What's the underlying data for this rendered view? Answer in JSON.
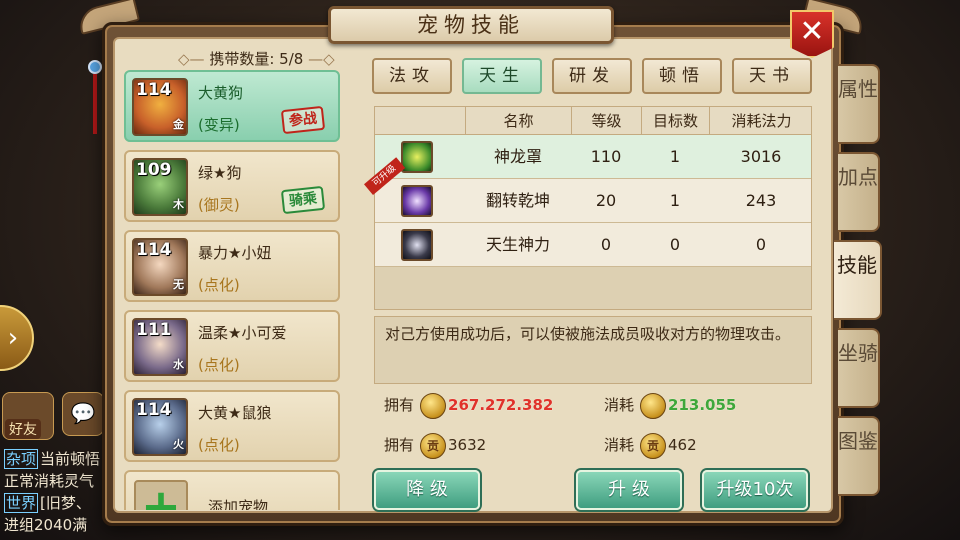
{
  "background": {
    "friend_label": "好友",
    "chat_lines": [
      {
        "tag": "杂项",
        "text": "当前顿悟"
      },
      {
        "tag": "",
        "text": "正常消耗灵气"
      },
      {
        "tag": "世界",
        "text": "[旧梦、"
      },
      {
        "tag": "",
        "text": "进组2040满"
      }
    ]
  },
  "title": "宠物技能",
  "close_label": "✕",
  "carry": {
    "label": "携带数量:",
    "value": "5/8"
  },
  "pets": [
    {
      "level": "114",
      "name": "大黄狗",
      "sub": "(变异)",
      "elem": "金",
      "stamp": "参战",
      "stamp_color": "#c0241a",
      "avatar_color": "#c8602a",
      "selected": true
    },
    {
      "level": "109",
      "name": "绿★狗",
      "sub": "(御灵)",
      "elem": "木",
      "stamp": "骑乘",
      "stamp_color": "#2a8a3a",
      "avatar_color": "#4a7a3a",
      "selected": false
    },
    {
      "level": "114",
      "name": "暴力★小妞",
      "sub": "(点化)",
      "elem": "无",
      "stamp": "",
      "avatar_color": "#a0785a",
      "selected": false
    },
    {
      "level": "111",
      "name": "温柔★小可爱",
      "sub": "(点化)",
      "elem": "水",
      "stamp": "",
      "avatar_color": "#7a6a8a",
      "selected": false
    },
    {
      "level": "114",
      "name": "大黄★鼠狼",
      "sub": "(点化)",
      "elem": "火",
      "stamp": "",
      "avatar_color": "#5a6a8a",
      "selected": false
    }
  ],
  "add_pet_label": "添加宠物",
  "tabs": [
    {
      "label": "法攻",
      "active": false
    },
    {
      "label": "天生",
      "active": true
    },
    {
      "label": "研发",
      "active": false
    },
    {
      "label": "顿悟",
      "active": false
    },
    {
      "label": "天书",
      "active": false
    }
  ],
  "table": {
    "headers": [
      "名称",
      "等级",
      "目标数",
      "消耗法力"
    ],
    "rows": [
      {
        "name": "神龙罩",
        "level": "110",
        "targets": "1",
        "cost": "3016",
        "icon_color": "#3a8a2a",
        "upgradable": false,
        "selected": true
      },
      {
        "name": "翻转乾坤",
        "level": "20",
        "targets": "1",
        "cost": "243",
        "icon_color": "#6a3aa8",
        "upgradable": true,
        "selected": false
      },
      {
        "name": "天生神力",
        "level": "0",
        "targets": "0",
        "cost": "0",
        "icon_color": "#3a3a4a",
        "upgradable": false,
        "selected": false
      }
    ],
    "upgrade_badge": "可升级"
  },
  "description": "对己方使用成功后，可以使被施法成员吸收对方的物理攻击。",
  "resources": {
    "own_label": "拥有",
    "cost_label": "消耗",
    "own_coin": "267.272.382",
    "cost_coin": "213.055",
    "own_contrib": "3632",
    "cost_contrib": "462"
  },
  "buttons": {
    "downgrade": "降  级",
    "upgrade": "升  级",
    "upgrade10": "升级10次"
  },
  "side_tabs": [
    {
      "label": "属性",
      "active": false
    },
    {
      "label": "加点",
      "active": false
    },
    {
      "label": "技能",
      "active": true
    },
    {
      "label": "坐骑",
      "active": false
    },
    {
      "label": "图鉴",
      "active": false
    }
  ],
  "colors": {
    "accent_green": "#3fa73a",
    "accent_red": "#e0322a",
    "panel_brown": "#4f3722"
  }
}
